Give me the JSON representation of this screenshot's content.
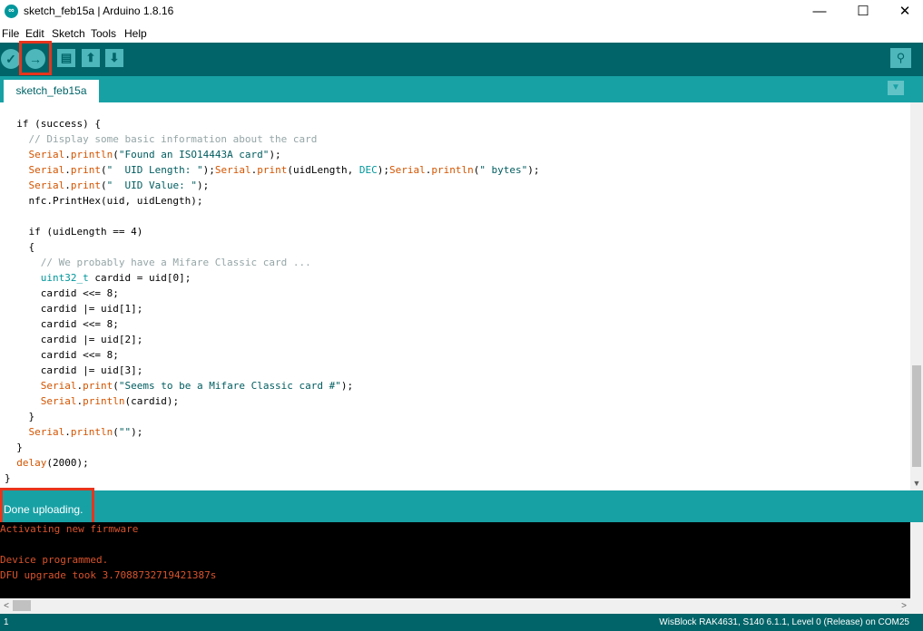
{
  "window": {
    "title": "sketch_feb15a | Arduino 1.8.16",
    "app_icon": "arduino-logo-icon",
    "controls": {
      "minimize": "—",
      "maximize": "☐",
      "close": "✕"
    }
  },
  "menu": [
    "File",
    "Edit",
    "Sketch",
    "Tools",
    "Help"
  ],
  "toolbar": {
    "verify_icon": "✓",
    "upload_icon": "→",
    "new_icon": "▤",
    "open_icon": "⬆",
    "save_icon": "⬇",
    "serial_monitor_icon": "⚲"
  },
  "tabs": [
    {
      "label": "sketch_feb15a"
    }
  ],
  "tab_menu_icon": "▼",
  "code_lines": [
    [
      {
        "t": "  if (success) {",
        "c": ""
      }
    ],
    [
      {
        "t": "    // Display some basic information about the card",
        "c": "com"
      }
    ],
    [
      {
        "t": "    ",
        "c": ""
      },
      {
        "t": "Serial",
        "c": "fn"
      },
      {
        "t": ".",
        "c": ""
      },
      {
        "t": "println",
        "c": "fn"
      },
      {
        "t": "(",
        "c": ""
      },
      {
        "t": "\"Found an ISO14443A card\"",
        "c": "str"
      },
      {
        "t": ");",
        "c": ""
      }
    ],
    [
      {
        "t": "    ",
        "c": ""
      },
      {
        "t": "Serial",
        "c": "fn"
      },
      {
        "t": ".",
        "c": ""
      },
      {
        "t": "print",
        "c": "fn"
      },
      {
        "t": "(",
        "c": ""
      },
      {
        "t": "\"  UID Length: \"",
        "c": "str"
      },
      {
        "t": ");",
        "c": ""
      },
      {
        "t": "Serial",
        "c": "fn"
      },
      {
        "t": ".",
        "c": ""
      },
      {
        "t": "print",
        "c": "fn"
      },
      {
        "t": "(uidLength, ",
        "c": ""
      },
      {
        "t": "DEC",
        "c": "kw"
      },
      {
        "t": ");",
        "c": ""
      },
      {
        "t": "Serial",
        "c": "fn"
      },
      {
        "t": ".",
        "c": ""
      },
      {
        "t": "println",
        "c": "fn"
      },
      {
        "t": "(",
        "c": ""
      },
      {
        "t": "\" bytes\"",
        "c": "str"
      },
      {
        "t": ");",
        "c": ""
      }
    ],
    [
      {
        "t": "    ",
        "c": ""
      },
      {
        "t": "Serial",
        "c": "fn"
      },
      {
        "t": ".",
        "c": ""
      },
      {
        "t": "print",
        "c": "fn"
      },
      {
        "t": "(",
        "c": ""
      },
      {
        "t": "\"  UID Value: \"",
        "c": "str"
      },
      {
        "t": ");",
        "c": ""
      }
    ],
    [
      {
        "t": "    nfc.PrintHex(uid, uidLength);",
        "c": ""
      }
    ],
    [
      {
        "t": "",
        "c": ""
      }
    ],
    [
      {
        "t": "    if (uidLength == 4)",
        "c": ""
      }
    ],
    [
      {
        "t": "    {",
        "c": ""
      }
    ],
    [
      {
        "t": "      // We probably have a Mifare Classic card ...",
        "c": "com"
      }
    ],
    [
      {
        "t": "      ",
        "c": ""
      },
      {
        "t": "uint32_t",
        "c": "kw"
      },
      {
        "t": " cardid = uid[0];",
        "c": ""
      }
    ],
    [
      {
        "t": "      cardid <<= 8;",
        "c": ""
      }
    ],
    [
      {
        "t": "      cardid |= uid[1];",
        "c": ""
      }
    ],
    [
      {
        "t": "      cardid <<= 8;",
        "c": ""
      }
    ],
    [
      {
        "t": "      cardid |= uid[2];",
        "c": ""
      }
    ],
    [
      {
        "t": "      cardid <<= 8;",
        "c": ""
      }
    ],
    [
      {
        "t": "      cardid |= uid[3];",
        "c": ""
      }
    ],
    [
      {
        "t": "      ",
        "c": ""
      },
      {
        "t": "Serial",
        "c": "fn"
      },
      {
        "t": ".",
        "c": ""
      },
      {
        "t": "print",
        "c": "fn"
      },
      {
        "t": "(",
        "c": ""
      },
      {
        "t": "\"Seems to be a Mifare Classic card #\"",
        "c": "str"
      },
      {
        "t": ");",
        "c": ""
      }
    ],
    [
      {
        "t": "      ",
        "c": ""
      },
      {
        "t": "Serial",
        "c": "fn"
      },
      {
        "t": ".",
        "c": ""
      },
      {
        "t": "println",
        "c": "fn"
      },
      {
        "t": "(cardid);",
        "c": ""
      }
    ],
    [
      {
        "t": "    }",
        "c": ""
      }
    ],
    [
      {
        "t": "    ",
        "c": ""
      },
      {
        "t": "Serial",
        "c": "fn"
      },
      {
        "t": ".",
        "c": ""
      },
      {
        "t": "println",
        "c": "fn"
      },
      {
        "t": "(",
        "c": ""
      },
      {
        "t": "\"\"",
        "c": "str"
      },
      {
        "t": ");",
        "c": ""
      }
    ],
    [
      {
        "t": "  }",
        "c": ""
      }
    ],
    [
      {
        "t": "  ",
        "c": ""
      },
      {
        "t": "delay",
        "c": "fn"
      },
      {
        "t": "(2000);",
        "c": ""
      }
    ],
    [
      {
        "t": "}",
        "c": ""
      }
    ]
  ],
  "status": {
    "message": "Done uploading."
  },
  "console_lines": [
    "Activating new firmware",
    "",
    "Device programmed.",
    "DFU upgrade took 3.7088732719421387s"
  ],
  "scroll": {
    "up_arrow": "▲",
    "down_arrow": "▼",
    "left_arrow": "<",
    "right_arrow": ">"
  },
  "bottom_bar": {
    "line_number": "1",
    "board_info": "WisBlock RAK4631, S140 6.1.1, Level 0 (Release) on COM25"
  },
  "colors": {
    "toolbar": "#006468",
    "tabbar": "#17a1a5",
    "highlight": "#e8341c",
    "console_text": "#d9532c"
  }
}
